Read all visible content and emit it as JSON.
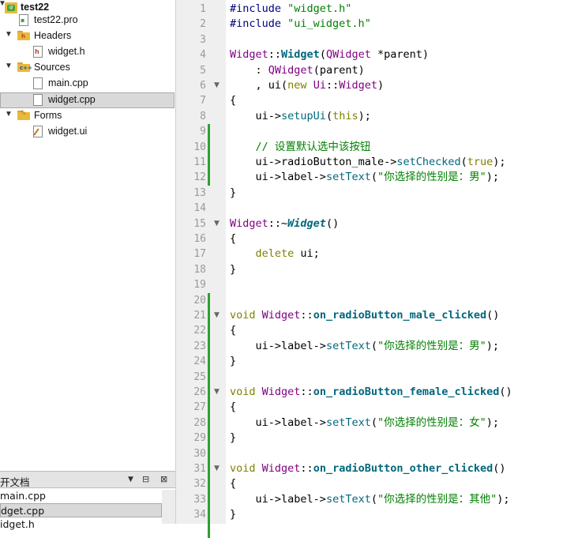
{
  "project_tree": {
    "project": "test22",
    "items": [
      {
        "label": "test22.pro",
        "kind": "pro"
      },
      {
        "label": "Headers",
        "kind": "folder",
        "badge": "h"
      },
      {
        "label": "widget.h",
        "kind": "header"
      },
      {
        "label": "Sources",
        "kind": "folder",
        "badge": "c++"
      },
      {
        "label": "main.cpp",
        "kind": "source"
      },
      {
        "label": "widget.cpp",
        "kind": "source",
        "selected": true
      },
      {
        "label": "Forms",
        "kind": "folder",
        "badge": ""
      },
      {
        "label": "widget.ui",
        "kind": "ui"
      }
    ]
  },
  "open_documents": {
    "title": "开文档",
    "items": [
      "main.cpp",
      "dget.cpp",
      "idget.h"
    ],
    "selected_index": 1
  },
  "editor": {
    "lines": [
      [
        [
          "prep",
          "#include "
        ],
        [
          "str",
          "\"widget.h\""
        ]
      ],
      [
        [
          "prep",
          "#include "
        ],
        [
          "str",
          "\"ui_widget.h\""
        ]
      ],
      [],
      [
        [
          "typ",
          "Widget"
        ],
        [
          "",
          "::"
        ],
        [
          "fnb",
          "Widget"
        ],
        [
          "",
          "("
        ],
        [
          "typ",
          "QWidget"
        ],
        [
          "",
          " *parent)"
        ]
      ],
      [
        [
          "",
          "    : "
        ],
        [
          "typ",
          "QWidget"
        ],
        [
          "",
          "(parent)"
        ]
      ],
      [
        [
          "",
          "    , "
        ],
        [
          "",
          "ui("
        ],
        [
          "kw",
          "new "
        ],
        [
          "typ",
          "Ui"
        ],
        [
          "",
          "::"
        ],
        [
          "typ",
          "Widget"
        ],
        [
          "",
          ")"
        ]
      ],
      [
        [
          "",
          "{"
        ]
      ],
      [
        [
          "",
          "    ui->"
        ],
        [
          "fn",
          "setupUi"
        ],
        [
          "",
          "("
        ],
        [
          "kw",
          "this"
        ],
        [
          "",
          ");"
        ]
      ],
      [],
      [
        [
          "cmt",
          "    // 设置默认选中该按钮"
        ]
      ],
      [
        [
          "",
          "    ui->"
        ],
        [
          "",
          "radioButton_male->"
        ],
        [
          "fn",
          "setChecked"
        ],
        [
          "",
          "("
        ],
        [
          "kw",
          "true"
        ],
        [
          "",
          ");"
        ]
      ],
      [
        [
          "",
          "    ui->"
        ],
        [
          "",
          "label->"
        ],
        [
          "fn",
          "setText"
        ],
        [
          "",
          "("
        ],
        [
          "str",
          "\"你选择的性别是：男\""
        ],
        [
          "",
          ");"
        ]
      ],
      [
        [
          "",
          "}"
        ]
      ],
      [],
      [
        [
          "typ",
          "Widget"
        ],
        [
          "",
          "::~"
        ],
        [
          "it",
          "Widget"
        ],
        [
          "",
          "()"
        ]
      ],
      [
        [
          "",
          "{"
        ]
      ],
      [
        [
          "kw",
          "    delete "
        ],
        [
          "",
          "ui;"
        ]
      ],
      [
        [
          "",
          "}"
        ]
      ],
      [],
      [],
      [
        [
          "kw",
          "void "
        ],
        [
          "typ",
          "Widget"
        ],
        [
          "",
          "::"
        ],
        [
          "fnb",
          "on_radioButton_male_clicked"
        ],
        [
          "",
          "()"
        ]
      ],
      [
        [
          "",
          "{"
        ]
      ],
      [
        [
          "",
          "    ui->"
        ],
        [
          "",
          "label->"
        ],
        [
          "fn",
          "setText"
        ],
        [
          "",
          "("
        ],
        [
          "str",
          "\"你选择的性别是：男\""
        ],
        [
          "",
          ");"
        ]
      ],
      [
        [
          "",
          "}"
        ]
      ],
      [],
      [
        [
          "kw",
          "void "
        ],
        [
          "typ",
          "Widget"
        ],
        [
          "",
          "::"
        ],
        [
          "fnb",
          "on_radioButton_female_clicked"
        ],
        [
          "",
          "()"
        ]
      ],
      [
        [
          "",
          "{"
        ]
      ],
      [
        [
          "",
          "    ui->"
        ],
        [
          "",
          "label->"
        ],
        [
          "fn",
          "setText"
        ],
        [
          "",
          "("
        ],
        [
          "str",
          "\"你选择的性别是：女\""
        ],
        [
          "",
          ");"
        ]
      ],
      [
        [
          "",
          "}"
        ]
      ],
      [],
      [
        [
          "kw",
          "void "
        ],
        [
          "typ",
          "Widget"
        ],
        [
          "",
          "::"
        ],
        [
          "fnb",
          "on_radioButton_other_clicked"
        ],
        [
          "",
          "()"
        ]
      ],
      [
        [
          "",
          "{"
        ]
      ],
      [
        [
          "",
          "    ui->"
        ],
        [
          "",
          "label->"
        ],
        [
          "fn",
          "setText"
        ],
        [
          "",
          "("
        ],
        [
          "str",
          "\"你选择的性别是：其他\""
        ],
        [
          "",
          ");"
        ]
      ],
      [
        [
          "",
          "}"
        ]
      ]
    ],
    "fold_lines": [
      6,
      15,
      21,
      26,
      31
    ],
    "changed_ranges": [
      [
        9,
        12
      ],
      [
        20,
        35
      ]
    ]
  },
  "colors": {
    "keyword": "#808000",
    "type": "#800080",
    "function": "#00677c",
    "string": "#008000",
    "change_marker": "#2e9e34"
  }
}
